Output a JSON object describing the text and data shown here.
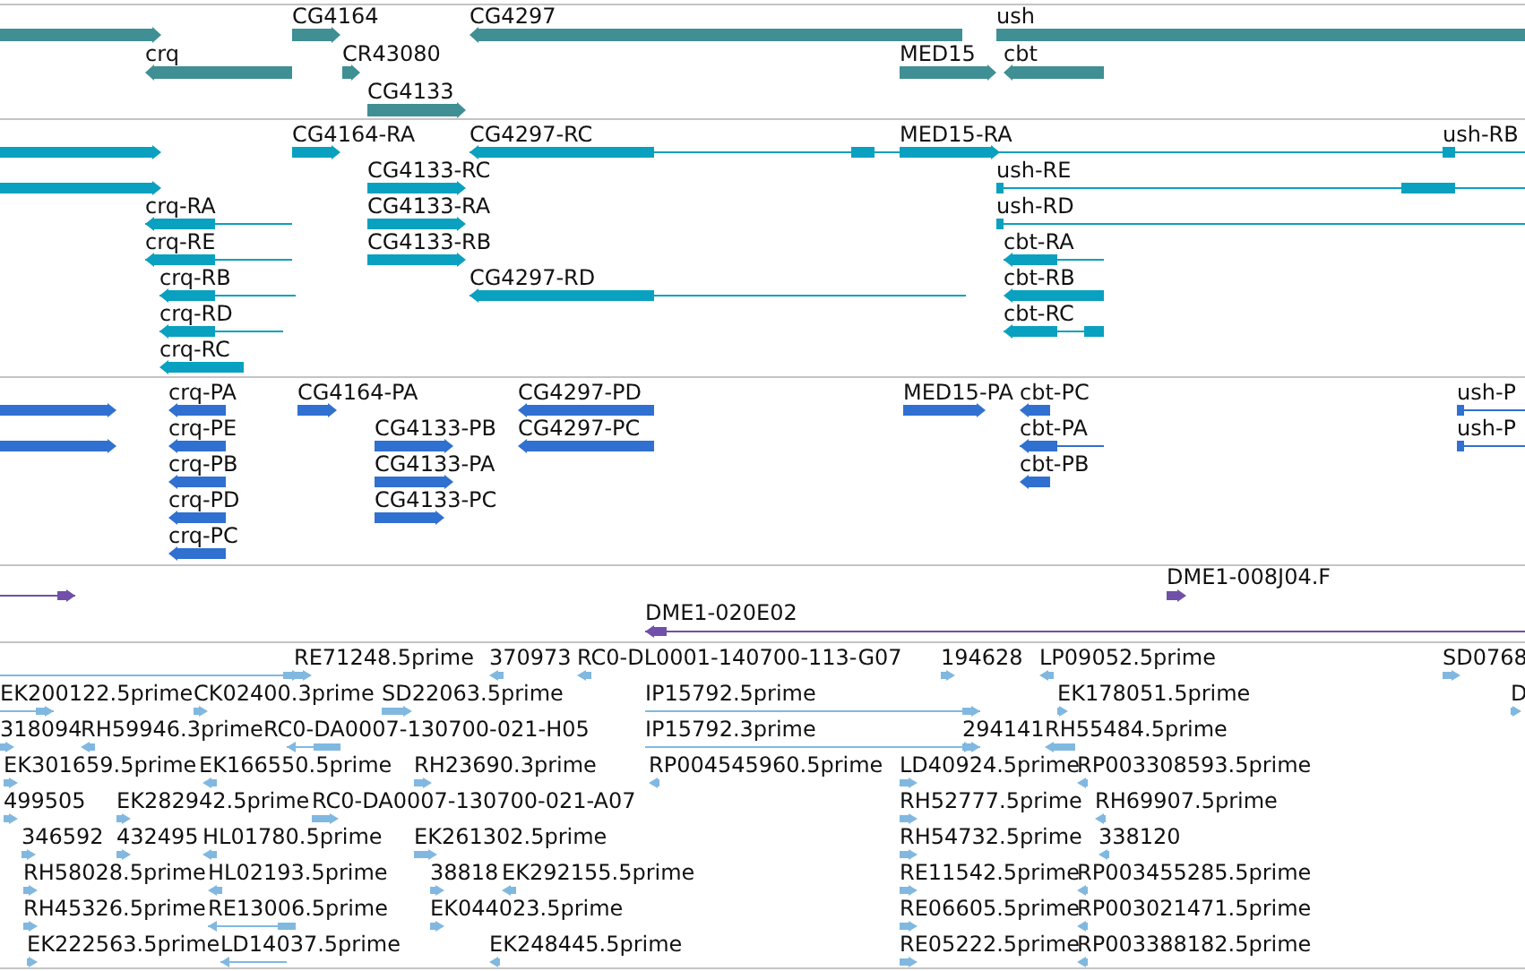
{
  "tracks": [
    {
      "kind": "gene",
      "features": [
        {
          "forward": true
        },
        {
          "label": "CG4164",
          "forward": true
        },
        {
          "label": "CG4297",
          "forward": false
        },
        {
          "label": "ush",
          "forward": true
        },
        {
          "label": "crq",
          "forward": false
        },
        {
          "label": "CR43080",
          "forward": true
        },
        {
          "label": "MED15",
          "forward": true
        },
        {
          "label": "cbt",
          "forward": false
        },
        {
          "label": "CG4133",
          "forward": true
        }
      ]
    },
    {
      "kind": "transcript",
      "features": [
        {
          "forward": true
        },
        {
          "label": "CG4164-RA",
          "forward": true
        },
        {
          "label": "CG4297-RC",
          "forward": false
        },
        {
          "label": "MED15-RA",
          "forward": true
        },
        {
          "label": "ush-RB",
          "forward": true
        },
        {
          "forward": true
        },
        {
          "label": "CG4133-RC",
          "forward": true
        },
        {
          "label": "ush-RE",
          "forward": true
        },
        {
          "label": "crq-RA",
          "forward": false
        },
        {
          "label": "CG4133-RA",
          "forward": true
        },
        {
          "label": "ush-RD",
          "forward": true
        },
        {
          "label": "crq-RE",
          "forward": false
        },
        {
          "label": "CG4133-RB",
          "forward": true
        },
        {
          "label": "cbt-RA",
          "forward": false
        },
        {
          "label": "crq-RB",
          "forward": false
        },
        {
          "label": "CG4297-RD",
          "forward": false
        },
        {
          "label": "cbt-RB",
          "forward": false
        },
        {
          "label": "crq-RD",
          "forward": false
        },
        {
          "label": "cbt-RC",
          "forward": false
        },
        {
          "label": "crq-RC",
          "forward": false
        }
      ]
    },
    {
      "kind": "protein",
      "features": [
        {
          "forward": true
        },
        {
          "label": "crq-PA",
          "forward": false
        },
        {
          "label": "CG4164-PA",
          "forward": true
        },
        {
          "label": "CG4297-PD",
          "forward": false
        },
        {
          "label": "MED15-PA",
          "forward": true
        },
        {
          "label": "cbt-PC",
          "forward": false
        },
        {
          "label": "ush-P",
          "forward": true
        },
        {
          "forward": true
        },
        {
          "label": "crq-PE",
          "forward": false
        },
        {
          "label": "CG4133-PB",
          "forward": true
        },
        {
          "label": "CG4297-PC",
          "forward": false
        },
        {
          "label": "cbt-PA",
          "forward": false
        },
        {
          "label": "ush-P",
          "forward": true
        },
        {
          "label": "crq-PB",
          "forward": false
        },
        {
          "label": "CG4133-PA",
          "forward": true
        },
        {
          "label": "cbt-PB",
          "forward": false
        },
        {
          "label": "crq-PD",
          "forward": false
        },
        {
          "label": "CG4133-PC",
          "forward": true
        },
        {
          "label": "crq-PC",
          "forward": false
        }
      ]
    },
    {
      "kind": "clone",
      "features": [
        {
          "forward": true
        },
        {
          "label": "DME1-008J04.F",
          "forward": true
        },
        {
          "label": "DME1-020E02",
          "forward": false
        }
      ]
    },
    {
      "kind": "est",
      "features": [
        {
          "forward": true
        },
        {
          "label": "RE71248.5prime",
          "forward": true
        },
        {
          "label": "370973",
          "forward": false
        },
        {
          "label": "RC0-DL0001-140700-113-G07",
          "forward": false
        },
        {
          "label": "194628",
          "forward": true
        },
        {
          "label": "LP09052.5prime",
          "forward": false
        },
        {
          "label": "SD0768",
          "forward": true
        },
        {
          "label": "EK200122.5prime",
          "forward": true
        },
        {
          "label": "CK02400.3prime",
          "forward": true
        },
        {
          "label": "SD22063.5prime",
          "forward": true
        },
        {
          "label": "IP15792.5prime",
          "forward": true
        },
        {
          "label": "EK178051.5prime",
          "forward": true
        },
        {
          "label": "D",
          "forward": true
        },
        {
          "label": "318094",
          "forward": true
        },
        {
          "label": "RH59946.3prime",
          "forward": false
        },
        {
          "label": "RC0-DA0007-130700-021-H05",
          "forward": false
        },
        {
          "label": "IP15792.3prime",
          "forward": true
        },
        {
          "label": "294141",
          "forward": true
        },
        {
          "label": "RH55484.5prime",
          "forward": false
        },
        {
          "label": "EK301659.5prime",
          "forward": true
        },
        {
          "label": "EK166550.5prime",
          "forward": false
        },
        {
          "label": "RH23690.3prime",
          "forward": true
        },
        {
          "label": "RP004545960.5prime",
          "forward": false
        },
        {
          "label": "LD40924.5prime",
          "forward": true
        },
        {
          "label": "RP003308593.5prime",
          "forward": false
        },
        {
          "label": "499505",
          "forward": true
        },
        {
          "label": "EK282942.5prime",
          "forward": true
        },
        {
          "label": "RC0-DA0007-130700-021-A07",
          "forward": true
        },
        {
          "label": "RH52777.5prime",
          "forward": true
        },
        {
          "label": "RH69907.5prime",
          "forward": false
        },
        {
          "label": "346592",
          "forward": true
        },
        {
          "label": "432495",
          "forward": true
        },
        {
          "label": "HL01780.5prime",
          "forward": false
        },
        {
          "label": "EK261302.5prime",
          "forward": true
        },
        {
          "label": "RH54732.5prime",
          "forward": true
        },
        {
          "label": "338120",
          "forward": false
        },
        {
          "label": "RH58028.5prime",
          "forward": true
        },
        {
          "label": "HL02193.5prime",
          "forward": false
        },
        {
          "label": "38818",
          "forward": true
        },
        {
          "label": "EK292155.5prime",
          "forward": false
        },
        {
          "label": "RE11542.5prime",
          "forward": true
        },
        {
          "label": "RP003455285.5prime",
          "forward": false
        },
        {
          "label": "RH45326.5prime",
          "forward": true
        },
        {
          "label": "RE13006.5prime",
          "forward": false
        },
        {
          "label": "EK044023.5prime",
          "forward": true
        },
        {
          "label": "RE06605.5prime",
          "forward": true
        },
        {
          "label": "RP003021471.5prime",
          "forward": false
        },
        {
          "label": "EK222563.5prime",
          "forward": true
        },
        {
          "label": "LD14037.5prime",
          "forward": false
        },
        {
          "label": "EK248445.5prime",
          "forward": false
        },
        {
          "label": "RE05222.5prime",
          "forward": true
        },
        {
          "label": "RP003388182.5prime",
          "forward": false
        }
      ]
    }
  ]
}
